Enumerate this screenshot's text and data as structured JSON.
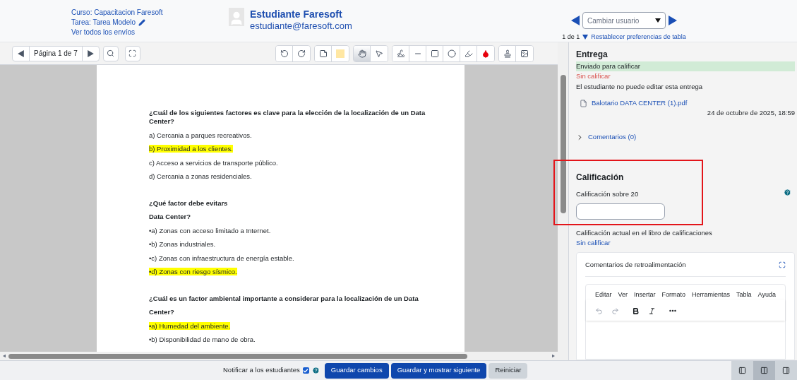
{
  "header": {
    "course_link": "Curso: Capacitacion Faresoft",
    "task_link": "Tarea: Tarea Modelo",
    "all_submissions_link": "Ver todos los envíos",
    "student_name": "Estudiante Faresoft",
    "student_email": "estudiante@faresoft.com",
    "user_select": {
      "placeholder": "Cambiar usuario"
    },
    "counter": "1 de 1",
    "reset_link": "Restablecer preferencias de tabla"
  },
  "pdf_toolbar": {
    "page_label": "Página 1 de 7",
    "tools": [
      {
        "selected": false
      },
      {
        "selected": false
      },
      {
        "selected": false
      },
      {
        "selected": false
      },
      {
        "selected": true
      },
      {
        "selected": false
      },
      {
        "selected": false
      },
      {
        "selected": false
      },
      {
        "selected": false
      },
      {
        "selected": false
      },
      {
        "selected": false
      },
      {
        "selected": false
      },
      {
        "selected": false
      },
      {
        "selected": false
      }
    ]
  },
  "document": {
    "lines": [
      {
        "kind": "question",
        "text": "¿Cuál de los siguientes factores es clave para la elección de la localización de un Data Center?",
        "highlighted": false
      },
      {
        "kind": "option",
        "text": "a) Cercania a parques recreativos.",
        "highlighted": false
      },
      {
        "kind": "option",
        "text": "b) Proximidad a los clientes.",
        "highlighted": true
      },
      {
        "kind": "option",
        "text": "c) Acceso a servicios de transporte público.",
        "highlighted": false
      },
      {
        "kind": "option",
        "text": "d) Cercania a zonas residenciales.",
        "highlighted": false
      },
      {
        "kind": "gap"
      },
      {
        "kind": "question",
        "text": "¿Qué factor debe evitars",
        "highlighted": false
      },
      {
        "kind": "question",
        "text": "Data Center?",
        "highlighted": false
      },
      {
        "kind": "option",
        "text": "•a) Zonas con acceso limitado a Internet.",
        "highlighted": false
      },
      {
        "kind": "option",
        "text": "•b) Zonas industriales.",
        "highlighted": false
      },
      {
        "kind": "option",
        "text": "•c) Zonas con infraestructura de energía estable.",
        "highlighted": false
      },
      {
        "kind": "option",
        "text": "•d) Zonas con riesgo sísmico.",
        "highlighted": true
      },
      {
        "kind": "gap"
      },
      {
        "kind": "question",
        "text": "¿Cuál es un factor ambiental importante a considerar para la localización de un Data",
        "highlighted": false
      },
      {
        "kind": "question",
        "text": "Center?",
        "highlighted": false
      },
      {
        "kind": "option",
        "text": "•a) Humedad del ambiente.",
        "highlighted": true
      },
      {
        "kind": "option",
        "text": "•b) Disponibilidad de mano de obra.",
        "highlighted": false
      }
    ]
  },
  "submission": {
    "title": "Entrega",
    "status": "Enviado para calificar",
    "grade_status": "Sin calificar",
    "edit_note": "El estudiante no puede editar esta entrega",
    "file_link": "Balotario DATA CENTER (1).pdf",
    "file_date": "24 de octubre de 2025, 18:59",
    "comments_link": "Comentarios (0)",
    "comments_expanded": false
  },
  "grading": {
    "title": "Calificación",
    "grade_label": "Calificación sobre 20",
    "gradebook_label": "Calificación actual en el libro de calificaciones",
    "gradebook_value": "Sin calificar"
  },
  "feedback": {
    "title": "Comentarios de retroalimentación",
    "menu": [
      "Editar",
      "Ver",
      "Insertar",
      "Formato",
      "Herramientas",
      "Tabla",
      "Ayuda"
    ]
  },
  "footer": {
    "notify_label": "Notificar a los estudiantes",
    "notify_checked": true,
    "buttons": [
      {
        "kind": "primary",
        "label": "Guardar cambios"
      },
      {
        "kind": "primary",
        "label": "Guardar y mostrar siguiente"
      },
      {
        "kind": "secondary",
        "label": "Reiniciar"
      }
    ],
    "layouts": [
      {
        "selected": false
      },
      {
        "selected": true
      },
      {
        "selected": false
      }
    ]
  }
}
